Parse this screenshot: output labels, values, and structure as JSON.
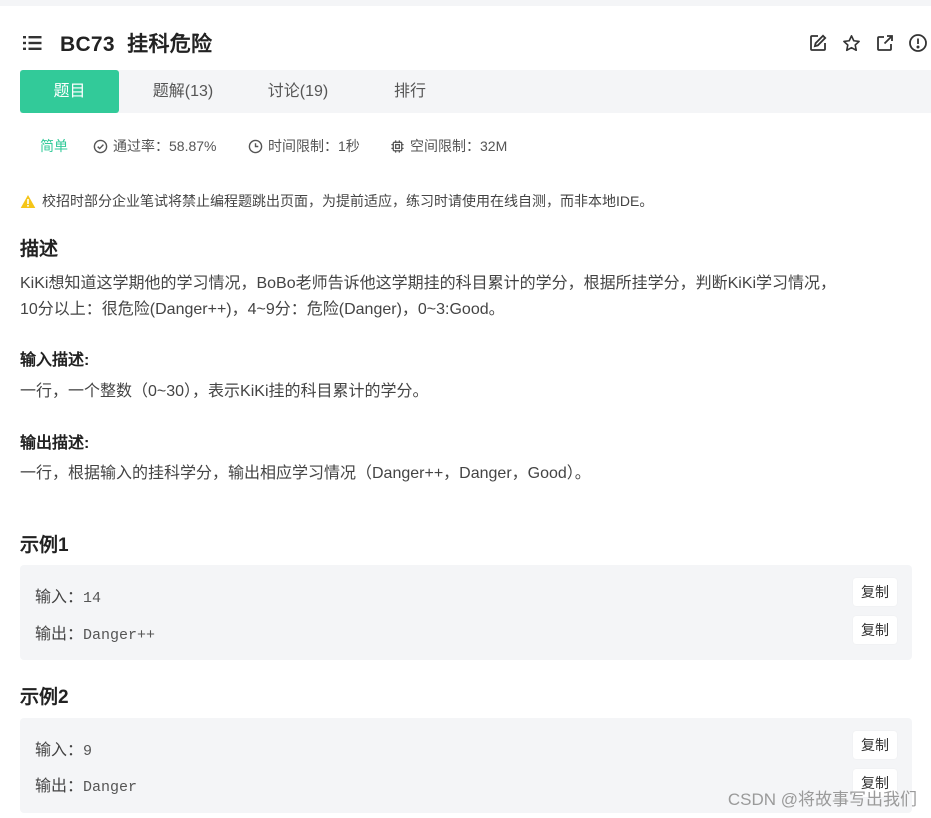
{
  "header": {
    "title": "BC73  挂科危险",
    "icons": [
      "list-icon",
      "edit-icon",
      "star-icon",
      "share-icon",
      "info-icon"
    ]
  },
  "tabs": [
    {
      "label": "题目",
      "active": true
    },
    {
      "label": "题解(13)",
      "active": false
    },
    {
      "label": "讨论(19)",
      "active": false
    },
    {
      "label": "排行",
      "active": false
    }
  ],
  "meta": {
    "difficulty": "简单",
    "pass_rate": "通过率：58.87%",
    "time_limit": "时间限制：1秒",
    "space_limit": "空间限制：32M"
  },
  "notice": "校招时部分企业笔试将禁止编程题跳出页面，为提前适应，练习时请使用在线自测，而非本地IDE。",
  "description": {
    "heading": "描述",
    "line1": "KiKi想知道这学期他的学习情况，BoBo老师告诉他这学期挂的科目累计的学分，根据所挂学分，判断KiKi学习情况，",
    "line2": "10分以上：很危险(Danger++)，4~9分：危险(Danger)，0~3:Good。"
  },
  "input_desc": {
    "heading": "输入描述:",
    "text": "一行，一个整数（0~30），表示KiKi挂的科目累计的学分。"
  },
  "output_desc": {
    "heading": "输出描述:",
    "text": "一行，根据输入的挂科学分，输出相应学习情况（Danger++，Danger，Good）。"
  },
  "examples": [
    {
      "heading": "示例1",
      "input_label": "输入：",
      "input": "14",
      "output_label": "输出：",
      "output": "Danger++",
      "copy": "复制"
    },
    {
      "heading": "示例2",
      "input_label": "输入：",
      "input": "9",
      "output_label": "输出：",
      "output": "Danger",
      "copy": "复制"
    }
  ],
  "watermark": "CSDN @将故事写出我们",
  "colors": {
    "accent": "#32ca99",
    "warning": "#f5c518",
    "panel": "#f4f5f7"
  }
}
